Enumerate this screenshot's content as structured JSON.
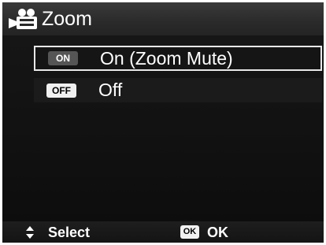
{
  "header": {
    "title": "Zoom",
    "icon": "movie-camera-icon"
  },
  "options": [
    {
      "badge": "ON",
      "label": "On (Zoom Mute)",
      "selected": true
    },
    {
      "badge": "OFF",
      "label": "Off",
      "selected": false
    }
  ],
  "footer": {
    "select_label": "Select",
    "select_icon": "up-down-arrows-icon",
    "ok_key": "OK",
    "ok_label": "OK"
  },
  "colors": {
    "background": "#0c0c0c",
    "text": "#ffffff",
    "selection_border": "#e8e8e8"
  }
}
